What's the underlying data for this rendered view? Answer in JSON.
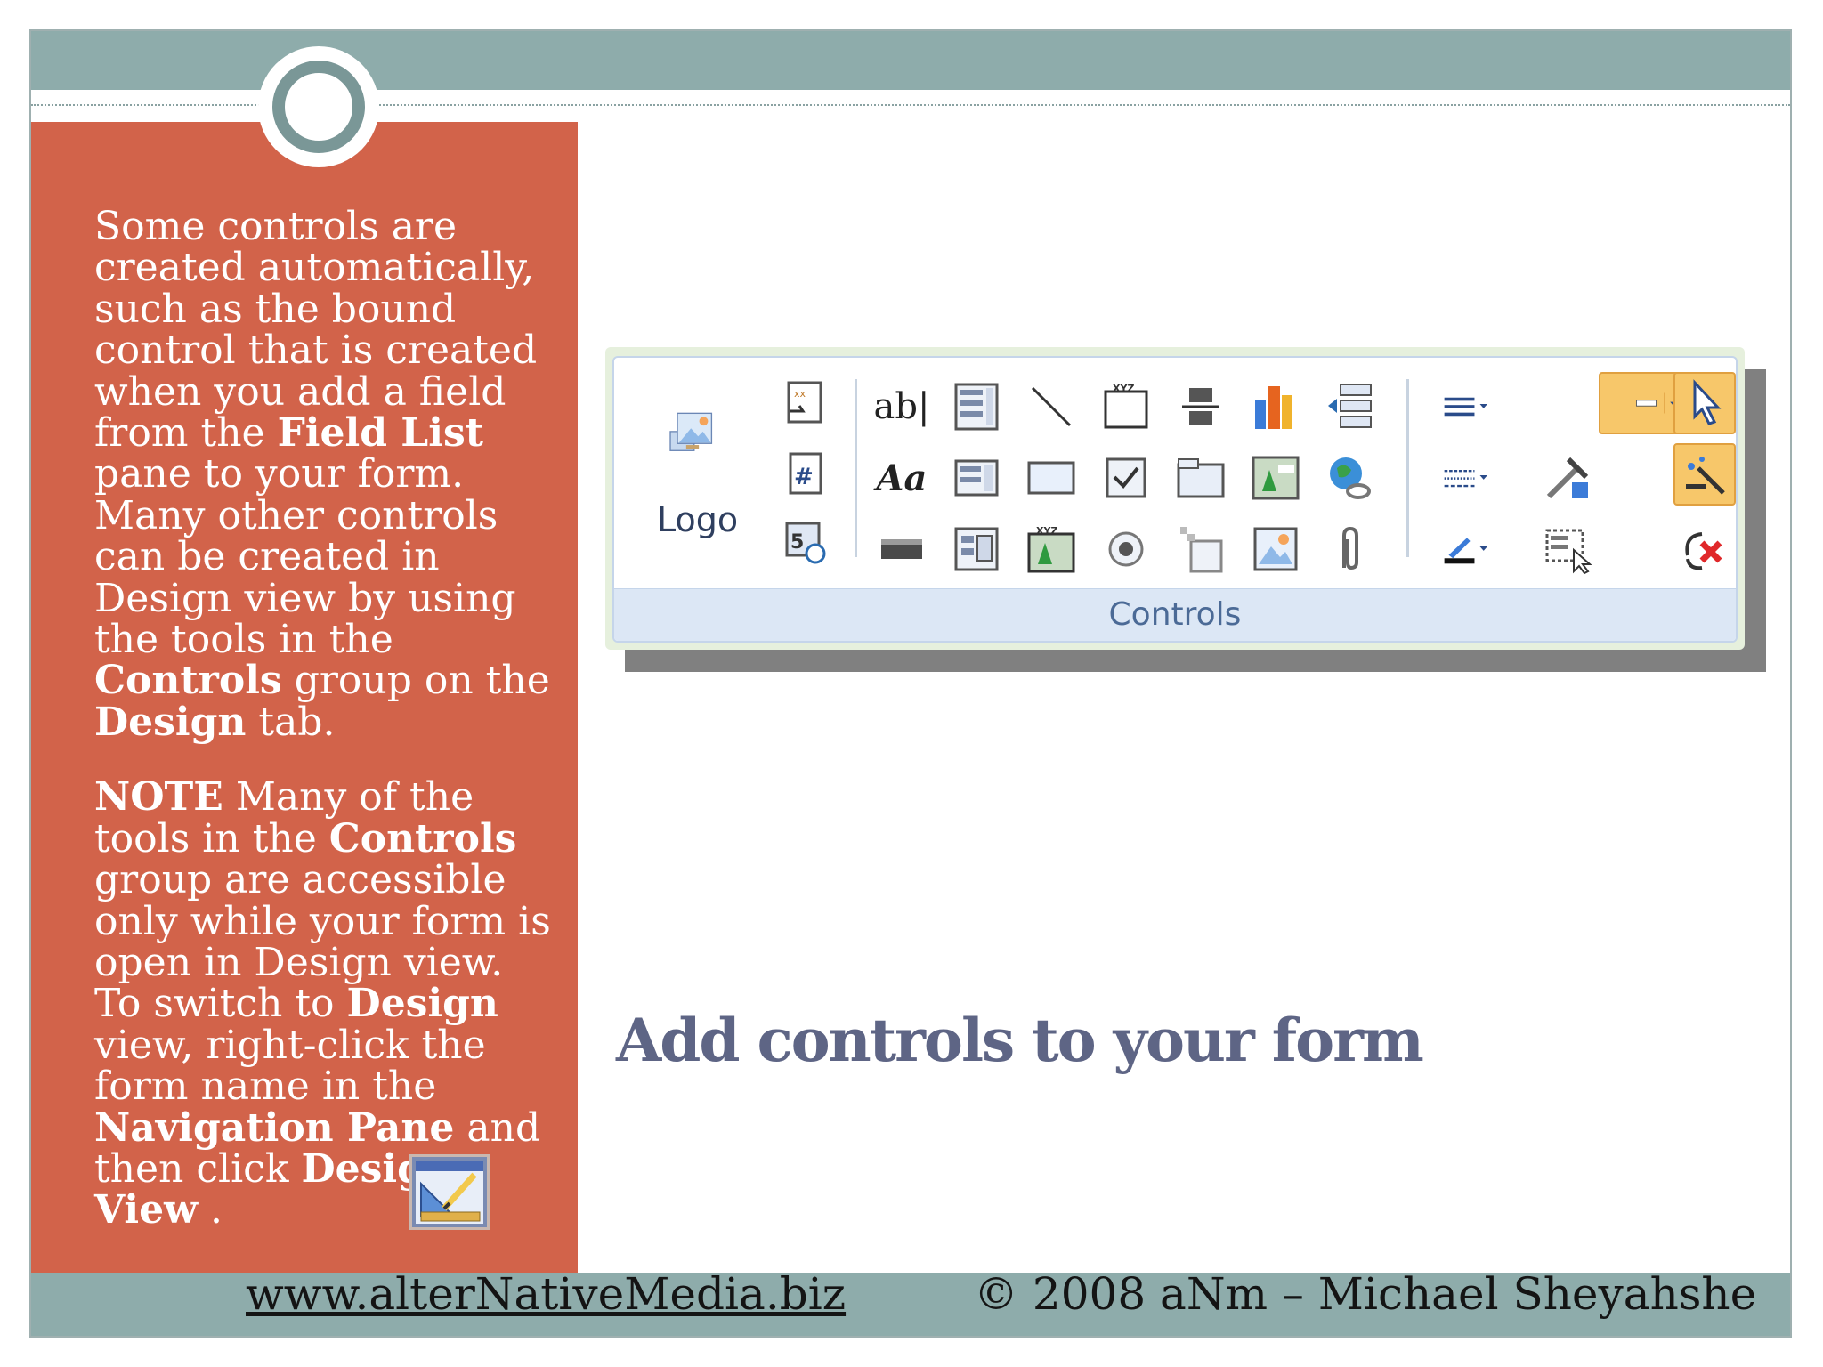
{
  "side_panel": {
    "para1": [
      {
        "t": "Some controls are created automatically, such as the bound control that is created when you add a field from the ",
        "b": false
      },
      {
        "t": "Field List",
        "b": true
      },
      {
        "t": " pane to your form. Many other controls can be created in Design view by using the tools in the ",
        "b": false
      },
      {
        "t": "Controls",
        "b": true
      },
      {
        "t": " group on the ",
        "b": false
      },
      {
        "t": "Design",
        "b": true
      },
      {
        "t": " tab.",
        "b": false
      }
    ],
    "para2": [
      {
        "t": "NOTE",
        "b": true
      },
      {
        "t": "   Many of the tools in the ",
        "b": false
      },
      {
        "t": "Controls",
        "b": true
      },
      {
        "t": " group are accessible only while your form is open in Design view. To switch to ",
        "b": false
      },
      {
        "t": "Design",
        "b": true
      },
      {
        "t": " view, right-click the form name in the ",
        "b": false
      },
      {
        "t": "Navigation Pane",
        "b": true
      },
      {
        "t": " and then click ",
        "b": false
      },
      {
        "t": "Design View",
        "b": true
      },
      {
        "t": " .",
        "b": false
      }
    ]
  },
  "ribbon": {
    "logo_label": "Logo",
    "group_label": "Controls",
    "textbox_label": "ab|",
    "label_tool": "Aa"
  },
  "title": "Add controls to your form",
  "footer": {
    "link": "www.alterNativeMedia.biz",
    "copyright": "© 2008 aNm – Michael Sheyahshe"
  },
  "colors": {
    "panel": "#d2634a",
    "bars": "#8eacab",
    "title": "#5e6585"
  }
}
